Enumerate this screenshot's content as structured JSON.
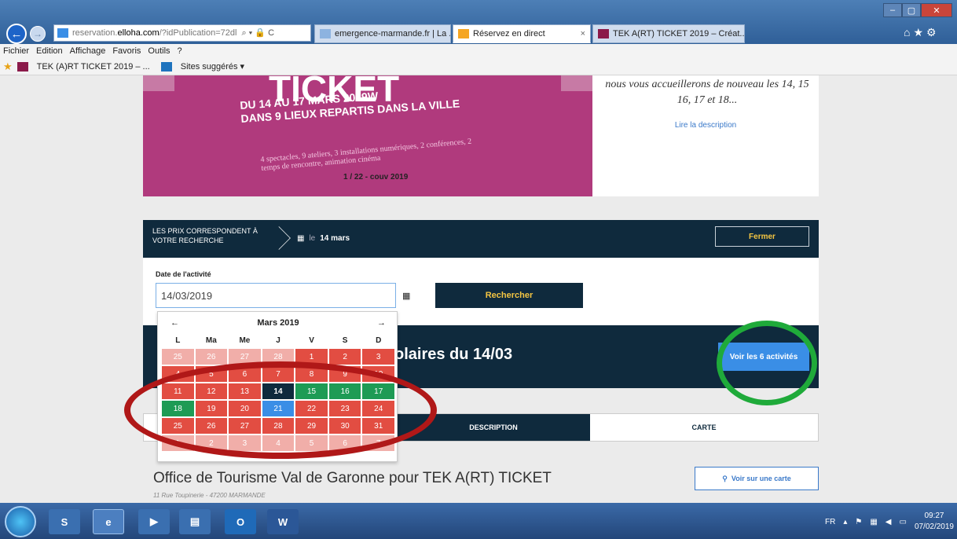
{
  "browser": {
    "address": "https://reservation.elloha.com/?idPublication=72dl",
    "address_host": "reservation.",
    "address_domain": "elloha.com",
    "address_path": "/?idPublication=72dl",
    "addr_controls": "⌕ ▾ 🔒 C",
    "tabs": [
      {
        "label": "emergence-marmande.fr | La ..."
      },
      {
        "label": "Réservez en direct",
        "close": "×"
      },
      {
        "label": "TEK A(RT) TICKET 2019 – Créat..."
      }
    ],
    "menu": [
      "Fichier",
      "Edition",
      "Affichage",
      "Favoris",
      "Outils",
      "?"
    ],
    "favorites": [
      "TEK (A)RT TICKET 2019 – ...",
      "Sites suggérés ▾"
    ]
  },
  "slider": {
    "big": "TICKET",
    "line1": "DU 14 AU 17 MARS 2019W",
    "line2": "DANS 9 LIEUX REPARTIS DANS LA VILLE",
    "small": "4 spectacles, 9 ateliers, 3 installations numériques, 2 conférences, 2 temps de rencontre, animation cinéma",
    "caption": "1 / 22 - couv 2019"
  },
  "description": {
    "text": "nous vous accueillerons de nouveau les 14, 15 16, 17 et 18...",
    "link": "Lire la description"
  },
  "bar": {
    "left": "LES PRIX CORRESPONDENT À VOTRE RECHERCHE",
    "date_prefix": "le",
    "date": "14 mars",
    "close": "Fermer"
  },
  "search": {
    "label": "Date de l'activité",
    "value": "14/03/2019",
    "button": "Rechercher"
  },
  "calendar": {
    "month": "Mars 2019",
    "prev": "←",
    "next": "→",
    "dow": [
      "L",
      "Ma",
      "Me",
      "J",
      "V",
      "S",
      "D"
    ],
    "days": [
      "25",
      "26",
      "27",
      "28",
      "1",
      "2",
      "3",
      "4",
      "5",
      "6",
      "7",
      "8",
      "9",
      "10",
      "11",
      "12",
      "13",
      "14",
      "15",
      "16",
      "17",
      "18",
      "19",
      "20",
      "21",
      "22",
      "23",
      "24",
      "25",
      "26",
      "27",
      "28",
      "29",
      "30",
      "31",
      "1",
      "2",
      "3",
      "4",
      "5",
      "6",
      "7"
    ]
  },
  "activity": {
    "title": "olaires du 14/03",
    "button": "Voir les 6 activités"
  },
  "tabs": {
    "description": "DESCRIPTION",
    "carte": "CARTE"
  },
  "office": {
    "name": "Office de Tourisme Val de Garonne pour TEK A(RT) TICKET",
    "address": "11 Rue Toupinerie - 47200 MARMANDE",
    "map_button": "Voir sur une carte"
  },
  "taskbar": {
    "lang": "FR",
    "time": "09:27",
    "date": "07/02/2019"
  },
  "colors": {
    "navy": "#0f2a3d",
    "red": "#e24d42",
    "green": "#1e9b55",
    "blue": "#3a8ee6",
    "gold": "#f4c542"
  }
}
